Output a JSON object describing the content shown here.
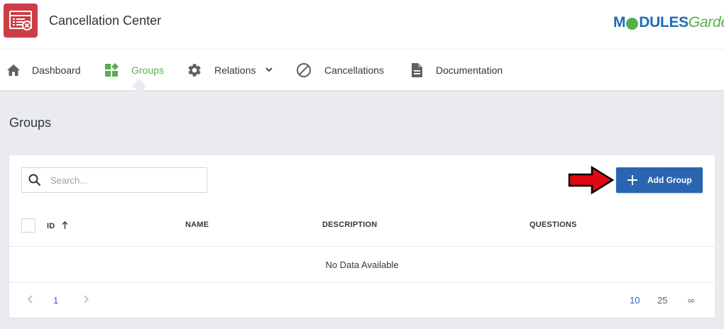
{
  "app": {
    "title": "Cancellation Center",
    "icon": "cancellation-window-icon"
  },
  "brand": {
    "part1": "M",
    "part2": "DULES",
    "part3": "Garden"
  },
  "colors": {
    "accent_red": "#cc3d45",
    "primary_blue": "#2a65b1",
    "active_green": "#55b04a",
    "arrow_red": "#e30613"
  },
  "nav": {
    "items": [
      {
        "label": "Dashboard",
        "icon": "home-icon"
      },
      {
        "label": "Groups",
        "icon": "groups-icon",
        "active": true
      },
      {
        "label": "Relations",
        "icon": "gear-icon",
        "has_dropdown": true
      },
      {
        "label": "Cancellations",
        "icon": "block-icon"
      },
      {
        "label": "Documentation",
        "icon": "document-icon"
      }
    ]
  },
  "page": {
    "heading": "Groups"
  },
  "toolbar": {
    "search_placeholder": "Search...",
    "add_label": "Add Group"
  },
  "table": {
    "columns": [
      {
        "label": "ID",
        "sorted": "asc"
      },
      {
        "label": "NAME"
      },
      {
        "label": "DESCRIPTION"
      },
      {
        "label": "QUESTIONS"
      }
    ],
    "empty_text": "No Data Available"
  },
  "pagination": {
    "current_page": "1",
    "per_page_options": [
      "10",
      "25",
      "∞"
    ],
    "selected_per_page": "10"
  }
}
